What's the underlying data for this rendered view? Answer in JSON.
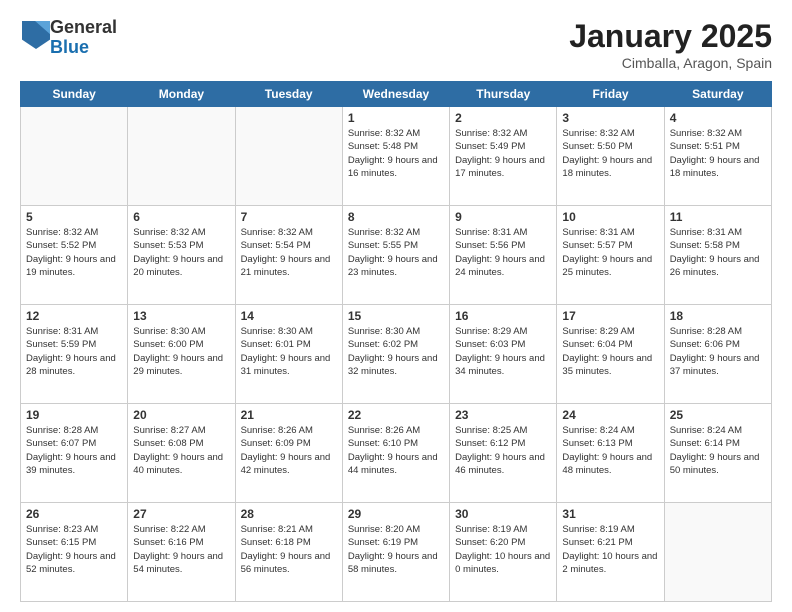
{
  "header": {
    "logo_general": "General",
    "logo_blue": "Blue",
    "title": "January 2025",
    "location": "Cimballa, Aragon, Spain"
  },
  "days_of_week": [
    "Sunday",
    "Monday",
    "Tuesday",
    "Wednesday",
    "Thursday",
    "Friday",
    "Saturday"
  ],
  "weeks": [
    [
      {
        "day": "",
        "info": ""
      },
      {
        "day": "",
        "info": ""
      },
      {
        "day": "",
        "info": ""
      },
      {
        "day": "1",
        "info": "Sunrise: 8:32 AM\nSunset: 5:48 PM\nDaylight: 9 hours and 16 minutes."
      },
      {
        "day": "2",
        "info": "Sunrise: 8:32 AM\nSunset: 5:49 PM\nDaylight: 9 hours and 17 minutes."
      },
      {
        "day": "3",
        "info": "Sunrise: 8:32 AM\nSunset: 5:50 PM\nDaylight: 9 hours and 18 minutes."
      },
      {
        "day": "4",
        "info": "Sunrise: 8:32 AM\nSunset: 5:51 PM\nDaylight: 9 hours and 18 minutes."
      }
    ],
    [
      {
        "day": "5",
        "info": "Sunrise: 8:32 AM\nSunset: 5:52 PM\nDaylight: 9 hours and 19 minutes."
      },
      {
        "day": "6",
        "info": "Sunrise: 8:32 AM\nSunset: 5:53 PM\nDaylight: 9 hours and 20 minutes."
      },
      {
        "day": "7",
        "info": "Sunrise: 8:32 AM\nSunset: 5:54 PM\nDaylight: 9 hours and 21 minutes."
      },
      {
        "day": "8",
        "info": "Sunrise: 8:32 AM\nSunset: 5:55 PM\nDaylight: 9 hours and 23 minutes."
      },
      {
        "day": "9",
        "info": "Sunrise: 8:31 AM\nSunset: 5:56 PM\nDaylight: 9 hours and 24 minutes."
      },
      {
        "day": "10",
        "info": "Sunrise: 8:31 AM\nSunset: 5:57 PM\nDaylight: 9 hours and 25 minutes."
      },
      {
        "day": "11",
        "info": "Sunrise: 8:31 AM\nSunset: 5:58 PM\nDaylight: 9 hours and 26 minutes."
      }
    ],
    [
      {
        "day": "12",
        "info": "Sunrise: 8:31 AM\nSunset: 5:59 PM\nDaylight: 9 hours and 28 minutes."
      },
      {
        "day": "13",
        "info": "Sunrise: 8:30 AM\nSunset: 6:00 PM\nDaylight: 9 hours and 29 minutes."
      },
      {
        "day": "14",
        "info": "Sunrise: 8:30 AM\nSunset: 6:01 PM\nDaylight: 9 hours and 31 minutes."
      },
      {
        "day": "15",
        "info": "Sunrise: 8:30 AM\nSunset: 6:02 PM\nDaylight: 9 hours and 32 minutes."
      },
      {
        "day": "16",
        "info": "Sunrise: 8:29 AM\nSunset: 6:03 PM\nDaylight: 9 hours and 34 minutes."
      },
      {
        "day": "17",
        "info": "Sunrise: 8:29 AM\nSunset: 6:04 PM\nDaylight: 9 hours and 35 minutes."
      },
      {
        "day": "18",
        "info": "Sunrise: 8:28 AM\nSunset: 6:06 PM\nDaylight: 9 hours and 37 minutes."
      }
    ],
    [
      {
        "day": "19",
        "info": "Sunrise: 8:28 AM\nSunset: 6:07 PM\nDaylight: 9 hours and 39 minutes."
      },
      {
        "day": "20",
        "info": "Sunrise: 8:27 AM\nSunset: 6:08 PM\nDaylight: 9 hours and 40 minutes."
      },
      {
        "day": "21",
        "info": "Sunrise: 8:26 AM\nSunset: 6:09 PM\nDaylight: 9 hours and 42 minutes."
      },
      {
        "day": "22",
        "info": "Sunrise: 8:26 AM\nSunset: 6:10 PM\nDaylight: 9 hours and 44 minutes."
      },
      {
        "day": "23",
        "info": "Sunrise: 8:25 AM\nSunset: 6:12 PM\nDaylight: 9 hours and 46 minutes."
      },
      {
        "day": "24",
        "info": "Sunrise: 8:24 AM\nSunset: 6:13 PM\nDaylight: 9 hours and 48 minutes."
      },
      {
        "day": "25",
        "info": "Sunrise: 8:24 AM\nSunset: 6:14 PM\nDaylight: 9 hours and 50 minutes."
      }
    ],
    [
      {
        "day": "26",
        "info": "Sunrise: 8:23 AM\nSunset: 6:15 PM\nDaylight: 9 hours and 52 minutes."
      },
      {
        "day": "27",
        "info": "Sunrise: 8:22 AM\nSunset: 6:16 PM\nDaylight: 9 hours and 54 minutes."
      },
      {
        "day": "28",
        "info": "Sunrise: 8:21 AM\nSunset: 6:18 PM\nDaylight: 9 hours and 56 minutes."
      },
      {
        "day": "29",
        "info": "Sunrise: 8:20 AM\nSunset: 6:19 PM\nDaylight: 9 hours and 58 minutes."
      },
      {
        "day": "30",
        "info": "Sunrise: 8:19 AM\nSunset: 6:20 PM\nDaylight: 10 hours and 0 minutes."
      },
      {
        "day": "31",
        "info": "Sunrise: 8:19 AM\nSunset: 6:21 PM\nDaylight: 10 hours and 2 minutes."
      },
      {
        "day": "",
        "info": ""
      }
    ]
  ]
}
